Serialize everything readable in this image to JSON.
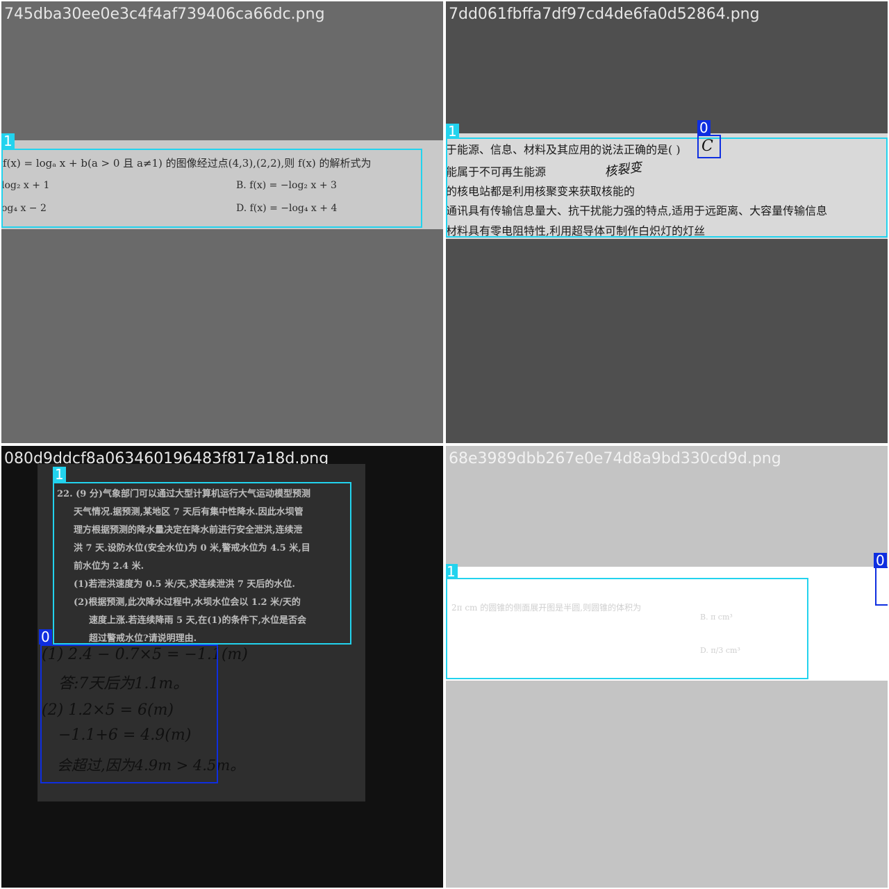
{
  "panels": [
    {
      "filename": "745dba30ee0e3c4f4af739406ca66dc.png",
      "colors": {
        "bg": "#6a6a6a",
        "strip": "#c9c9c9",
        "text": "#2b2b2b",
        "filename": "#e6e6e6"
      },
      "lines": [
        "f(x) = logₐ x + b(a > 0 且 a≠1) 的图像经过点(4,3),(2,2),则 f(x) 的解析式为",
        "log₂ x + 1",
        "B. f(x) = −log₂ x + 3",
        "og₄ x − 2",
        "D. f(x) = −log₄ x + 4"
      ],
      "boxes": [
        {
          "label": "1",
          "class": 1
        }
      ]
    },
    {
      "filename": "7dd061fbffa7df97cd4de6fa0d52864.png",
      "colors": {
        "bg": "#4f4f4f",
        "strip": "#d9d9d9",
        "text": "#1a1a1a",
        "filename": "#e6e6e6"
      },
      "lines": [
        "于能源、信息、材料及其应用的说法正确的是(    )",
        "能属于不可再生能源",
        "的核电站都是利用核聚变来获取核能的",
        "通讯具有传输信息量大、抗干扰能力强的特点,适用于远距离、大容量传输信息",
        "材料具有零电阻特性,利用超导体可制作白炽灯的灯丝"
      ],
      "handwriting": [
        "C",
        "核裂变"
      ],
      "boxes": [
        {
          "label": "0",
          "class": 0
        },
        {
          "label": "1",
          "class": 1
        }
      ]
    },
    {
      "filename": "080d9ddcf8a063460196483f817a18d.png",
      "colors": {
        "bg": "#111111",
        "paper": "#2e2e2e",
        "text": "#bdbdbd",
        "ink": "#101010",
        "filename": "#e6e6e6"
      },
      "lines": [
        "22. (9 分)气象部门可以通过大型计算机运行大气运动模型预测",
        "天气情况.据预测,某地区 7 天后有集中性降水.因此水坝管",
        "理方根据预测的降水量决定在降水前进行安全泄洪,连续泄",
        "洪 7 天.设防水位(安全水位)为 0 米,警戒水位为 4.5 米,目",
        "前水位为 2.4 米.",
        "(1)若泄洪速度为 0.5 米/天,求连续泄洪 7 天后的水位.",
        "(2)根据预测,此次降水过程中,水坝水位会以 1.2 米/天的",
        "速度上涨.若连续降雨 5 天,在(1)的条件下,水位是否会",
        "超过警戒水位?请说明理由."
      ],
      "handwriting": [
        "(1) 2.4 − 0.7×5 = −1.1(m)",
        "答:7天后为1.1m。",
        "(2) 1.2×5 = 6(m)",
        "−1.1+6 = 4.9(m)",
        "会超过,因为4.9m > 4.5m。"
      ],
      "boxes": [
        {
          "label": "1",
          "class": 1
        },
        {
          "label": "0",
          "class": 0
        }
      ]
    },
    {
      "filename": "68e3989dbb267e0e74d8a9bd330cd9d.png",
      "colors": {
        "bg": "#c4c4c4",
        "strip": "#ffffff",
        "text": "#cfcfcf",
        "filename": "#f2f2f2"
      },
      "lines": [
        "2π cm 的圆锥的侧面展开图是半圆,则圆锥的体积为",
        "B. π cm³",
        "D. π/3 cm³"
      ],
      "boxes": [
        {
          "label": "1",
          "class": 1
        },
        {
          "label": "0",
          "class": 0
        }
      ]
    }
  ]
}
